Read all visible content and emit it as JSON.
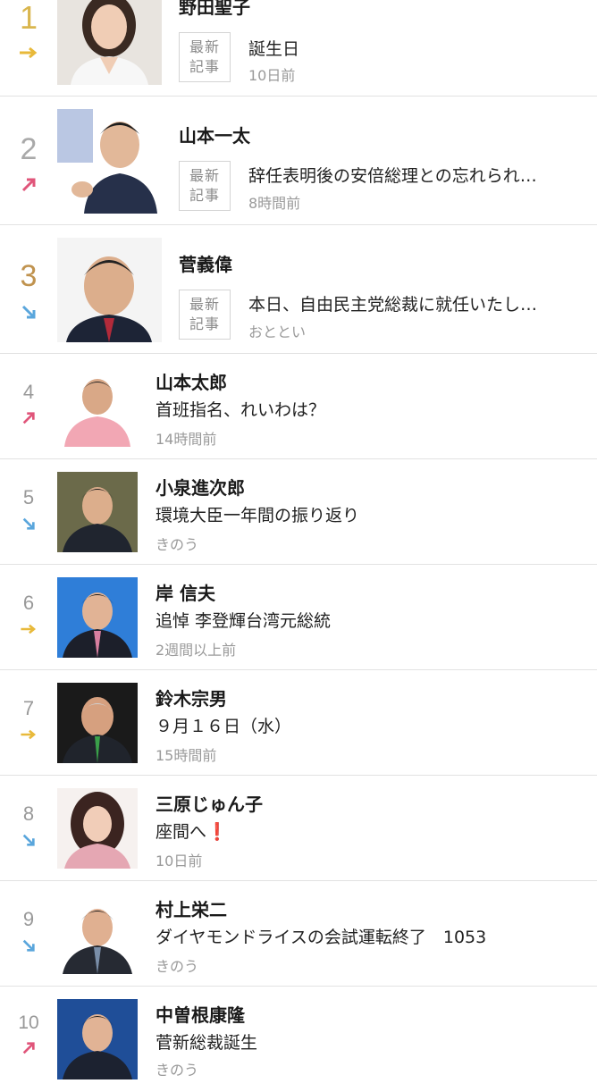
{
  "ranking": {
    "badge_line1": "最新",
    "badge_line2": "記事",
    "items": [
      {
        "rank": "1",
        "trend": "flat",
        "name": "野田聖子",
        "title": "誕生日",
        "time": "10日前"
      },
      {
        "rank": "2",
        "trend": "up",
        "name": "山本一太",
        "title": "辞任表明後の安倍総理との忘れられ…",
        "time": "8時間前"
      },
      {
        "rank": "3",
        "trend": "down",
        "name": "菅義偉",
        "title": "本日、自由民主党総裁に就任いたし…",
        "time": "おととい"
      },
      {
        "rank": "4",
        "trend": "up",
        "name": "山本太郎",
        "title": "首班指名、れいわは？",
        "time": "14時間前"
      },
      {
        "rank": "5",
        "trend": "down",
        "name": "小泉進次郎",
        "title": "環境大臣一年間の振り返り",
        "time": "きのう"
      },
      {
        "rank": "6",
        "trend": "flat",
        "name": "岸 信夫",
        "title": "追悼 李登輝台湾元総統",
        "time": "2週間以上前"
      },
      {
        "rank": "7",
        "trend": "flat",
        "name": "鈴木宗男",
        "title": "９月１６日（水）",
        "time": "15時間前"
      },
      {
        "rank": "8",
        "trend": "down",
        "name": "三原じゅん子",
        "title": "座間へ",
        "title_suffix": "❗",
        "time": "10日前"
      },
      {
        "rank": "9",
        "trend": "down",
        "name": "村上栄二",
        "title": "ダイヤモンドライスの会試運転終了　1053",
        "time": "きのう"
      },
      {
        "rank": "10",
        "trend": "up",
        "name": "中曽根康隆",
        "title": "菅新総裁誕生",
        "time": "きのう"
      }
    ]
  },
  "colors": {
    "gold": "#d9b64e",
    "silver": "#a9a9a9",
    "bronze": "#c0934f",
    "other": "#999999",
    "up": "#e0557a",
    "down": "#5aa6dc",
    "flat": "#e8b93a"
  }
}
